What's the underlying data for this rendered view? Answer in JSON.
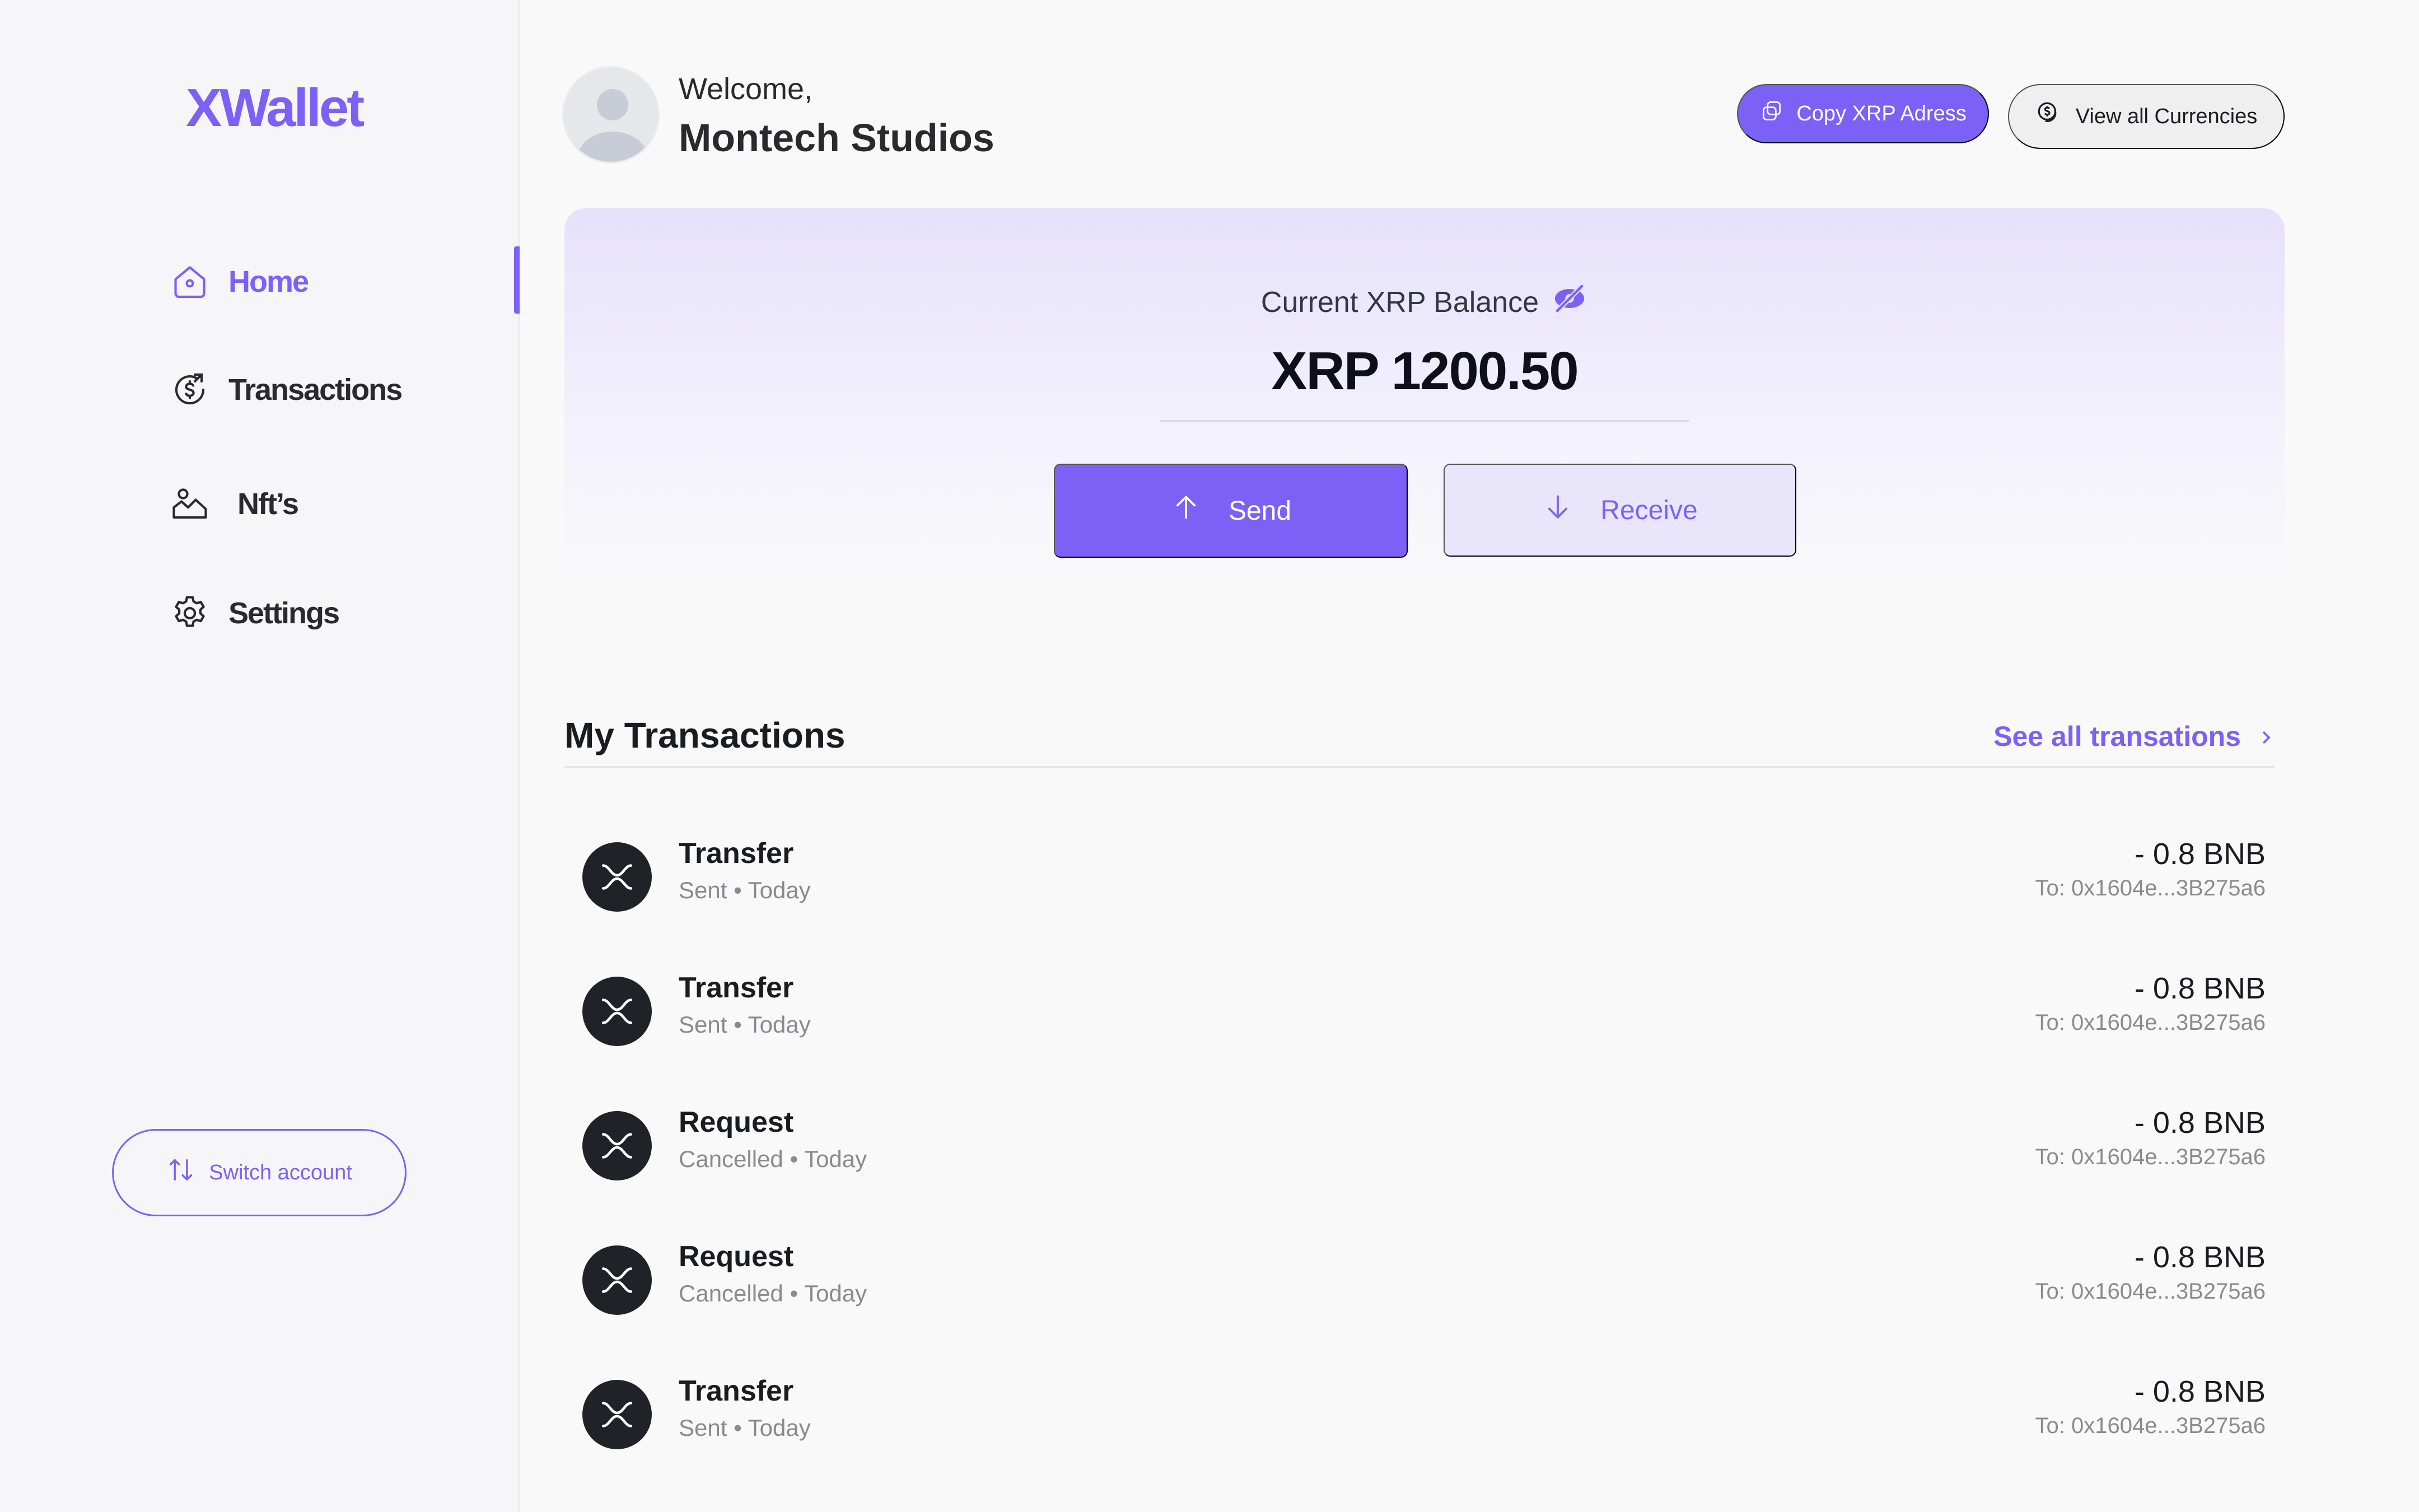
{
  "app": {
    "logo": "XWallet"
  },
  "sidebar": {
    "items": [
      {
        "label": "Home",
        "icon": "home-icon",
        "active": true
      },
      {
        "label": "Transactions",
        "icon": "dollar-cycle-icon",
        "active": false
      },
      {
        "label": "Nft’s",
        "icon": "image-icon",
        "active": false
      },
      {
        "label": "Settings",
        "icon": "gear-icon",
        "active": false
      }
    ],
    "switch_account_label": "Switch account"
  },
  "header": {
    "welcome": "Welcome,",
    "user_name": "Montech Studios",
    "copy_label": "Copy XRP Adress",
    "view_label": "View all Currencies"
  },
  "balance": {
    "label": "Current XRP Balance",
    "amount": "XRP 1200.50",
    "send_label": "Send",
    "receive_label": "Receive"
  },
  "transactions": {
    "title": "My Transactions",
    "see_all": "See all transations",
    "rows": [
      {
        "type": "Transfer",
        "sub": "Sent • Today",
        "amount": "- 0.8 BNB",
        "to": "To: 0x1604e...3B275a6"
      },
      {
        "type": "Transfer",
        "sub": "Sent • Today",
        "amount": "- 0.8 BNB",
        "to": "To: 0x1604e...3B275a6"
      },
      {
        "type": "Request",
        "sub": "Cancelled • Today",
        "amount": "- 0.8 BNB",
        "to": "To: 0x1604e...3B275a6"
      },
      {
        "type": "Request",
        "sub": "Cancelled • Today",
        "amount": "- 0.8 BNB",
        "to": "To: 0x1604e...3B275a6"
      },
      {
        "type": "Transfer",
        "sub": "Sent • Today",
        "amount": "- 0.8 BNB",
        "to": "To: 0x1604e...3B275a6"
      }
    ]
  },
  "colors": {
    "accent": "#7b61f5",
    "background": "#f9f9f9",
    "sidebar": "#f6f6f8",
    "coin": "#1f2226"
  }
}
